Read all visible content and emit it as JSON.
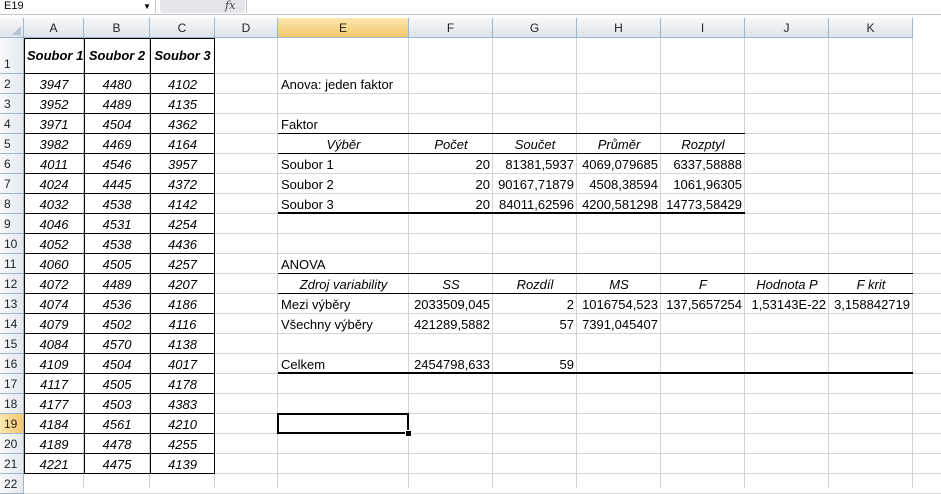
{
  "name_box": "E19",
  "fx_label": "fx",
  "columns": [
    "A",
    "B",
    "C",
    "D",
    "E",
    "F",
    "G",
    "H",
    "I",
    "J",
    "K"
  ],
  "rows": [
    "1",
    "2",
    "3",
    "4",
    "5",
    "6",
    "7",
    "8",
    "9",
    "10",
    "11",
    "12",
    "13",
    "14",
    "15",
    "16",
    "17",
    "18",
    "19",
    "20",
    "21",
    "22"
  ],
  "selected_column": "E",
  "selected_row": "19",
  "source_headers": [
    "Soubor 1",
    "Soubor 2",
    "Soubor 3"
  ],
  "source_data": [
    [
      "3947",
      "4480",
      "4102"
    ],
    [
      "3952",
      "4489",
      "4135"
    ],
    [
      "3971",
      "4504",
      "4362"
    ],
    [
      "3982",
      "4469",
      "4164"
    ],
    [
      "4011",
      "4546",
      "3957"
    ],
    [
      "4024",
      "4445",
      "4372"
    ],
    [
      "4032",
      "4538",
      "4142"
    ],
    [
      "4046",
      "4531",
      "4254"
    ],
    [
      "4052",
      "4538",
      "4436"
    ],
    [
      "4060",
      "4505",
      "4257"
    ],
    [
      "4072",
      "4489",
      "4207"
    ],
    [
      "4074",
      "4536",
      "4186"
    ],
    [
      "4079",
      "4502",
      "4116"
    ],
    [
      "4084",
      "4570",
      "4138"
    ],
    [
      "4109",
      "4504",
      "4017"
    ],
    [
      "4117",
      "4505",
      "4178"
    ],
    [
      "4177",
      "4503",
      "4383"
    ],
    [
      "4184",
      "4561",
      "4210"
    ],
    [
      "4189",
      "4478",
      "4255"
    ],
    [
      "4221",
      "4475",
      "4139"
    ]
  ],
  "anova_title": "Anova: jeden faktor",
  "faktor_label": "Faktor",
  "summary_headers": [
    "Výběr",
    "Počet",
    "Součet",
    "Průměr",
    "Rozptyl"
  ],
  "summary_rows": [
    [
      "Soubor 1",
      "20",
      "81381,5937",
      "4069,079685",
      "6337,58888"
    ],
    [
      "Soubor 2",
      "20",
      "90167,71879",
      "4508,38594",
      "1061,96305"
    ],
    [
      "Soubor 3",
      "20",
      "84011,62596",
      "4200,581298",
      "14773,58429"
    ]
  ],
  "anova_label": "ANOVA",
  "anova_headers": [
    "Zdroj variability",
    "SS",
    "Rozdíl",
    "MS",
    "F",
    "Hodnota P",
    "F krit"
  ],
  "anova_rows": [
    [
      "Mezi výběry",
      "2033509,045",
      "2",
      "1016754,523",
      "137,5657254",
      "1,53143E-22",
      "3,158842719"
    ],
    [
      "Všechny výběry",
      "421289,5882",
      "57",
      "7391,045407",
      "",
      "",
      ""
    ],
    [
      "",
      "",
      "",
      "",
      "",
      "",
      ""
    ],
    [
      "Celkem",
      "2454798,633",
      "59",
      "",
      "",
      "",
      ""
    ]
  ]
}
